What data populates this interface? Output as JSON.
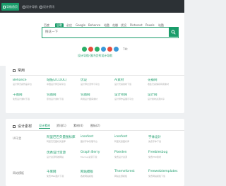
{
  "topbar": {
    "tabs": [
      {
        "label": "导航首页",
        "active": true
      },
      {
        "label": "设计导航",
        "active": false
      },
      {
        "label": "设计资讯",
        "active": false
      }
    ]
  },
  "search": {
    "engines": [
      "百度",
      "谷歌",
      "必应",
      "Google",
      "Behance",
      "站酷",
      "花瓣",
      "优设",
      "Pinterest",
      "Pexels",
      "站酷"
    ],
    "active_engine": "谷歌",
    "placeholder": "搜这一下"
  },
  "socials": {
    "colors": [
      "#2aae67",
      "#e84b3c",
      "#2aae67",
      "#3a99d8",
      "#e84b3c",
      "#3a99d8"
    ],
    "trailing": "TKt"
  },
  "tagline": "设计导航·国内优秀设计导航",
  "common": {
    "title": "常用",
    "sites": [
      {
        "name": "Behance",
        "desc": "设计师灵感作品平台"
      },
      {
        "name": "站酷(ZCOOL)",
        "desc": "中国设计师互动平台"
      },
      {
        "name": "优设",
        "desc": "设计师交流学习平台"
      },
      {
        "name": "AI素材",
        "desc": "设计灵感素材下载"
      },
      {
        "name": "花瓣网",
        "desc": "收集灵感保存有用素材"
      },
      {
        "name": "千图网",
        "desc": "免费设计素材下载"
      },
      {
        "name": "包图网",
        "desc": "原创设计素材下载"
      },
      {
        "name": "包图网",
        "desc": "商用设计图库素材"
      },
      {
        "name": "设计师网",
        "desc": "设计师作品展示平台"
      },
      {
        "name": "设计网",
        "desc": "设计素材资源共享"
      }
    ]
  },
  "design": {
    "title": "设计素材",
    "subtabs": [
      "设计素材",
      "资讯(1)",
      "素材(4)",
      "图标(2)"
    ],
    "rows": [
      {
        "label": "UI干货",
        "links": [
          {
            "name": "阿里巴巴矢量图标库",
            "desc": "阿里巴巴图标矢量库"
          },
          {
            "name": "iconfont",
            "desc": "图标字体管理平台"
          },
          {
            "name": "iconfont",
            "desc": "阿里矢量图标库"
          },
          {
            "name": "字体设计",
            "desc": "免费字体下载"
          }
        ]
      },
      {
        "label": "",
        "links": [
          {
            "name": "优秀设计资源",
            "desc": "设计资源导航网站"
          },
          {
            "name": "Graph Berry",
            "desc": "Mockup资源下载"
          },
          {
            "name": "Pixeden",
            "desc": "免费设计资源"
          },
          {
            "name": "Freebiesbug",
            "desc": "免费PSD素材"
          }
        ]
      },
      {
        "label": "网站模板",
        "links": [
          {
            "name": "千库网",
            "desc": "免费PNG图片下载"
          },
          {
            "name": "网站模板",
            "desc": "各类网站模板"
          },
          {
            "name": "Themeforest",
            "desc": "网站主题模板"
          },
          {
            "name": "Freewebtemplates",
            "desc": "免费网站模板下载"
          }
        ]
      }
    ]
  }
}
